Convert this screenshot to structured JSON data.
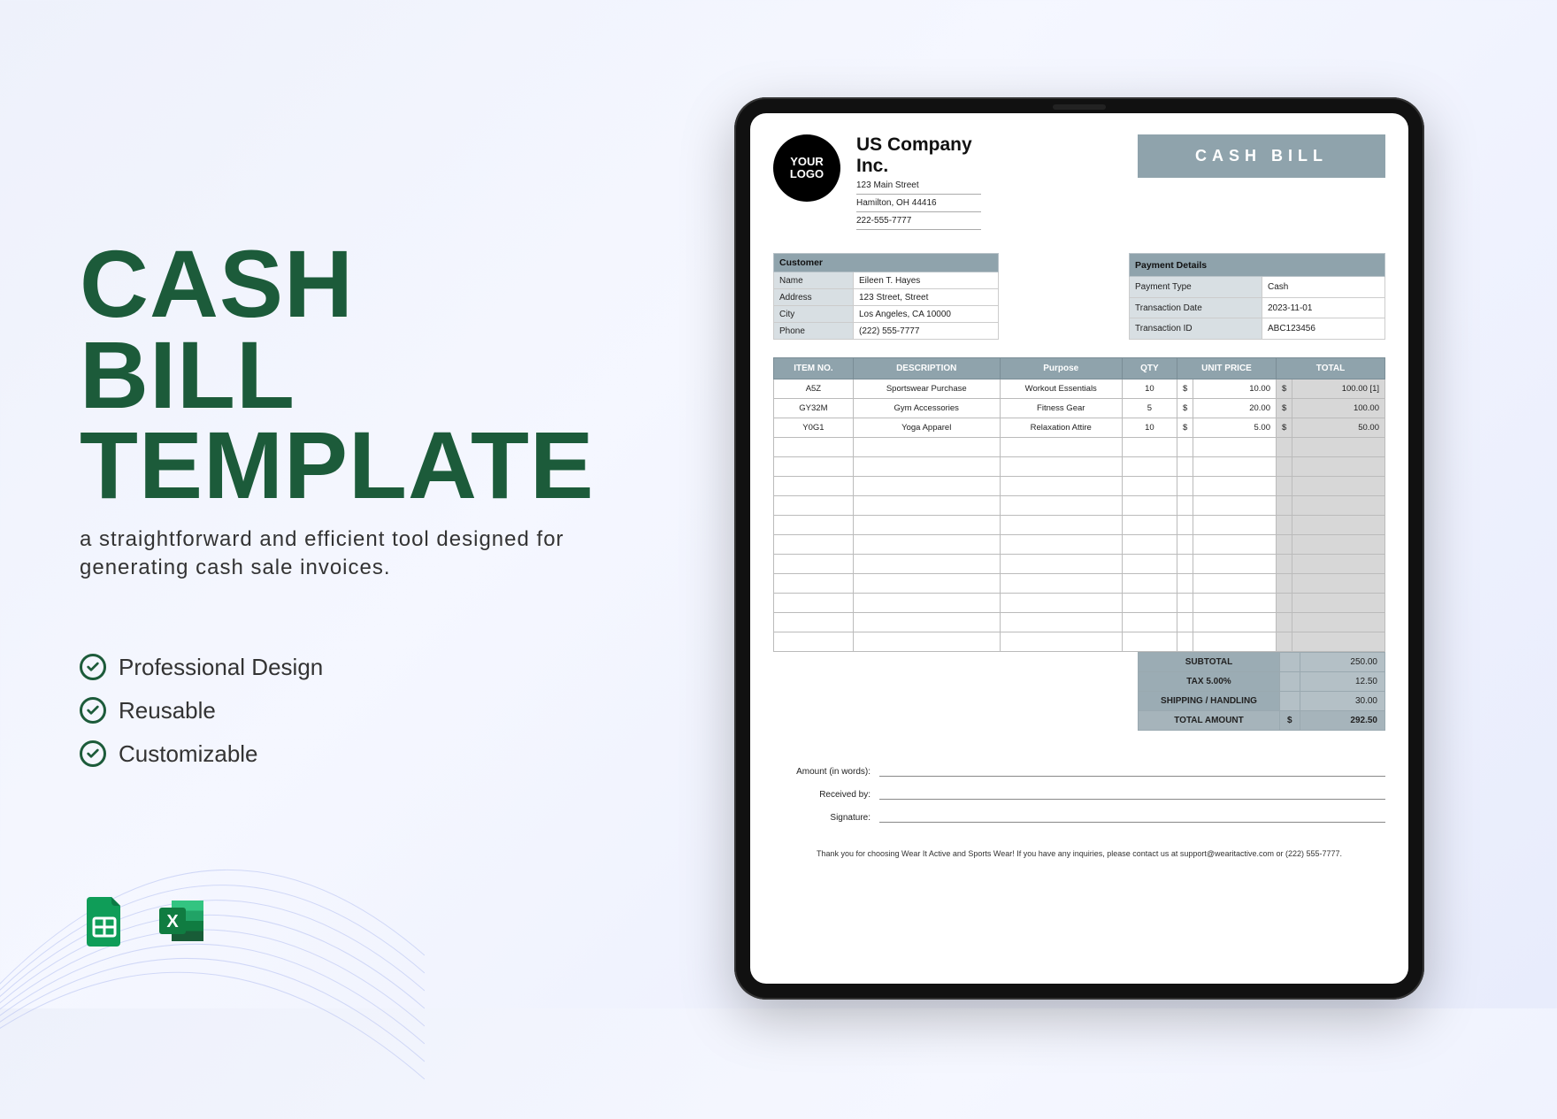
{
  "hero": {
    "title_line1": "CASH BILL",
    "title_line2": "TEMPLATE",
    "subtitle": "a straightforward and efficient tool designed for generating cash sale invoices."
  },
  "features": [
    "Professional Design",
    "Reusable",
    "Customizable"
  ],
  "app_icons": [
    "google-sheets",
    "excel"
  ],
  "document": {
    "logo_text_1": "YOUR",
    "logo_text_2": "LOGO",
    "company_name": "US Company Inc.",
    "company_street": "123 Main Street",
    "company_city": "Hamilton, OH  44416",
    "company_phone": "222-555-7777",
    "banner": "CASH BILL",
    "customer_header": "Customer",
    "customer": {
      "name_label": "Name",
      "name": "Eileen T. Hayes",
      "address_label": "Address",
      "address": "123 Street, Street",
      "city_label": "City",
      "city": "Los Angeles, CA 10000",
      "phone_label": "Phone",
      "phone": "(222) 555-7777"
    },
    "payment_header": "Payment Details",
    "payment": {
      "type_label": "Payment Type",
      "type": "Cash",
      "date_label": "Transaction Date",
      "date": "2023-11-01",
      "id_label": "Transaction ID",
      "id": "ABC123456"
    },
    "items_headers": {
      "item_no": "ITEM NO.",
      "description": "DESCRIPTION",
      "purpose": "Purpose",
      "qty": "QTY",
      "unit_price": "UNIT PRICE",
      "total": "TOTAL"
    },
    "currency": "$",
    "items": [
      {
        "no": "A5Z",
        "desc": "Sportswear Purchase",
        "purpose": "Workout Essentials",
        "qty": "10",
        "unit": "10.00",
        "total": "100.00 [1]"
      },
      {
        "no": "GY32M",
        "desc": "Gym Accessories",
        "purpose": "Fitness Gear",
        "qty": "5",
        "unit": "20.00",
        "total": "100.00"
      },
      {
        "no": "Y0G1",
        "desc": "Yoga Apparel",
        "purpose": "Relaxation Attire",
        "qty": "10",
        "unit": "5.00",
        "total": "50.00"
      }
    ],
    "empty_rows": 11,
    "summary": {
      "subtotal_label": "SUBTOTAL",
      "subtotal": "250.00",
      "tax_label": "TAX  5.00%",
      "tax": "12.50",
      "shipping_label": "SHIPPING / HANDLING",
      "shipping": "30.00",
      "total_label": "TOTAL AMOUNT",
      "total": "292.50"
    },
    "sig": {
      "amount_words": "Amount (in words):",
      "received_by": "Received by:",
      "signature": "Signature:"
    },
    "footer": "Thank you for choosing Wear It Active and Sports Wear! If you have any inquiries, please contact us at support@wearitactive.com or (222) 555-7777."
  }
}
